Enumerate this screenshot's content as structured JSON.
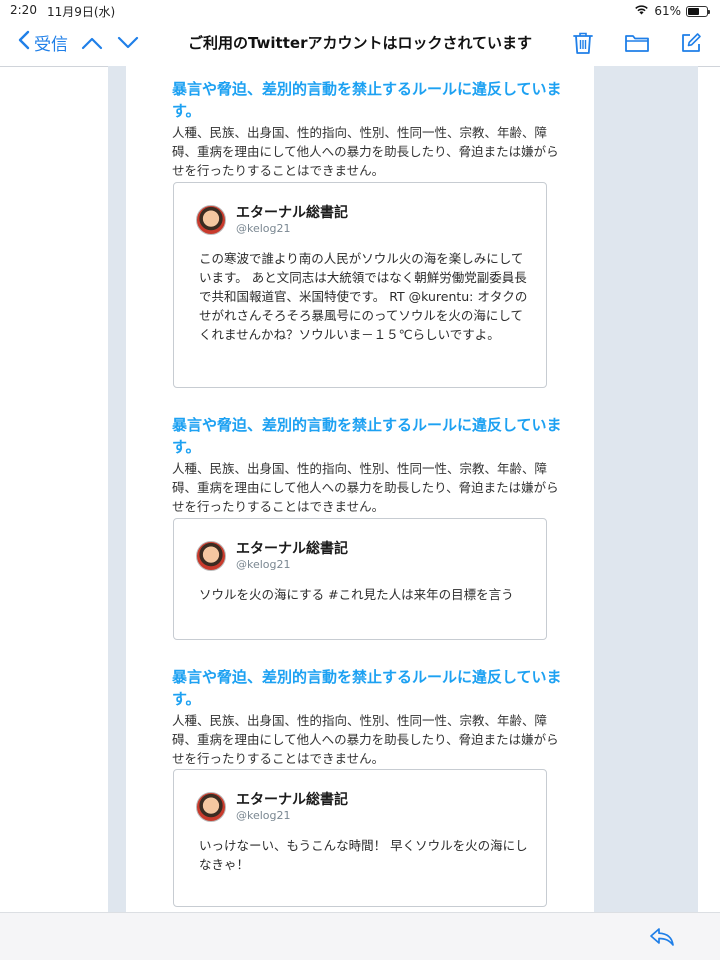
{
  "status": {
    "time": "2:20",
    "date": "11月9日(水)",
    "battery_percent": "61%",
    "battery_level": 0.61
  },
  "nav": {
    "back_label": "受信",
    "title": "ご利用のTwitterアカウントはロックされています"
  },
  "icons": {
    "back": "chevron-left-icon",
    "prev": "chevron-up-icon",
    "next": "chevron-down-icon",
    "trash": "trash-icon",
    "folder": "folder-icon",
    "compose": "compose-icon",
    "reply": "reply-icon",
    "wifi": "wifi-icon",
    "battery": "battery-icon"
  },
  "colors": {
    "accent": "#1f7fe8",
    "violation_title": "#1da1f2",
    "side_panel": "#dfe6ee"
  },
  "violations": [
    {
      "title": "暴言や脅迫、差別的言動を禁止するルールに違反しています。",
      "description": "人種、民族、出身国、性的指向、性別、性同一性、宗教、年齢、障碍、重病を理由にして他人への暴力を助長したり、脅迫または嫌がらせを行ったりすることはできません。",
      "tweet": {
        "author": "エターナル総書記",
        "handle": "@kelog21",
        "text": "この寒波で誰より南の人民がソウル火の海を楽しみにしています。 あと文同志は大統領ではなく朝鮮労働党副委員長で共和国報道官、米国特使です。 RT @kurentu: オタクのせがれさんそろそろ暴風号にのってソウルを火の海にしてくれませんかね？ソウルいま－１５℃らしいですよ。"
      }
    },
    {
      "title": "暴言や脅迫、差別的言動を禁止するルールに違反しています。",
      "description": "人種、民族、出身国、性的指向、性別、性同一性、宗教、年齢、障碍、重病を理由にして他人への暴力を助長したり、脅迫または嫌がらせを行ったりすることはできません。",
      "tweet": {
        "author": "エターナル総書記",
        "handle": "@kelog21",
        "text": "ソウルを火の海にする #これ見た人は来年の目標を言う"
      }
    },
    {
      "title": "暴言や脅迫、差別的言動を禁止するルールに違反しています。",
      "description": "人種、民族、出身国、性的指向、性別、性同一性、宗教、年齢、障碍、重病を理由にして他人への暴力を助長したり、脅迫または嫌がらせを行ったりすることはできません。",
      "tweet": {
        "author": "エターナル総書記",
        "handle": "@kelog21",
        "text": "いっけなーい、もうこんな時間！ 早くソウルを火の海にしなきゃ！"
      }
    }
  ]
}
